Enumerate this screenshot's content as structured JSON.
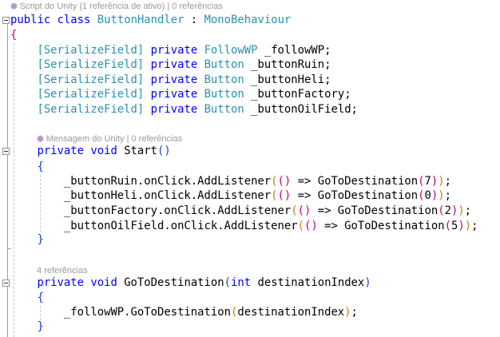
{
  "codelens": {
    "class": "Script do Unity (1 referência de ativo) | 0 referências",
    "start": "Mensagem do Unity | 0 referências",
    "goto": "4 referências"
  },
  "code_lines": [
    {
      "tokens": [
        [
          "public",
          "kw"
        ],
        [
          " ",
          ""
        ],
        [
          "class",
          "kw"
        ],
        [
          " ",
          ""
        ],
        [
          "ButtonHandler",
          "ty"
        ],
        [
          " : ",
          ""
        ],
        [
          "MonoBehaviour",
          "ty"
        ]
      ]
    },
    {
      "tokens": [
        [
          "{",
          "b2"
        ]
      ]
    },
    {
      "tokens": [
        [
          "    ",
          ""
        ],
        [
          "[SerializeField]",
          "ty"
        ],
        [
          " ",
          ""
        ],
        [
          "private",
          "kw"
        ],
        [
          " ",
          ""
        ],
        [
          "FollowWP",
          "ty"
        ],
        [
          " _followWP;",
          ""
        ]
      ]
    },
    {
      "tokens": [
        [
          "    ",
          ""
        ],
        [
          "[SerializeField]",
          "ty"
        ],
        [
          " ",
          ""
        ],
        [
          "private",
          "kw"
        ],
        [
          " ",
          ""
        ],
        [
          "Button",
          "ty"
        ],
        [
          " _buttonRuin;",
          ""
        ]
      ]
    },
    {
      "tokens": [
        [
          "    ",
          ""
        ],
        [
          "[SerializeField]",
          "ty"
        ],
        [
          " ",
          ""
        ],
        [
          "private",
          "kw"
        ],
        [
          " ",
          ""
        ],
        [
          "Button",
          "ty"
        ],
        [
          " _buttonHeli;",
          ""
        ]
      ]
    },
    {
      "tokens": [
        [
          "    ",
          ""
        ],
        [
          "[SerializeField]",
          "ty"
        ],
        [
          " ",
          ""
        ],
        [
          "private",
          "kw"
        ],
        [
          " ",
          ""
        ],
        [
          "Button",
          "ty"
        ],
        [
          " _buttonFactory;",
          ""
        ]
      ]
    },
    {
      "tokens": [
        [
          "    ",
          ""
        ],
        [
          "[SerializeField]",
          "ty"
        ],
        [
          " ",
          ""
        ],
        [
          "private",
          "kw"
        ],
        [
          " ",
          ""
        ],
        [
          "Button",
          "ty"
        ],
        [
          " _buttonOilField;",
          ""
        ]
      ]
    },
    {
      "tokens": [
        [
          "    ",
          ""
        ],
        [
          "private",
          "kw"
        ],
        [
          " ",
          ""
        ],
        [
          "void",
          "kw"
        ],
        [
          " Start",
          ""
        ],
        [
          "()",
          "b3"
        ]
      ]
    },
    {
      "tokens": [
        [
          "    ",
          ""
        ],
        [
          "{",
          "b3"
        ]
      ]
    },
    {
      "tokens": [
        [
          "        _buttonRuin.onClick.AddListener",
          ""
        ],
        [
          "(",
          "b1"
        ],
        [
          "()",
          "b2"
        ],
        [
          " => GoToDestination",
          ""
        ],
        [
          "(",
          "b2"
        ],
        [
          "7",
          ""
        ],
        [
          ")",
          "b2"
        ],
        [
          ")",
          "b1"
        ],
        [
          ";",
          ""
        ]
      ]
    },
    {
      "tokens": [
        [
          "        _buttonHeli.onClick.AddListener",
          ""
        ],
        [
          "(",
          "b1"
        ],
        [
          "()",
          "b2"
        ],
        [
          " => GoToDestination",
          ""
        ],
        [
          "(",
          "b2"
        ],
        [
          "0",
          ""
        ],
        [
          ")",
          "b2"
        ],
        [
          ")",
          "b1"
        ],
        [
          ";",
          ""
        ]
      ]
    },
    {
      "tokens": [
        [
          "        _buttonFactory.onClick.AddListener",
          ""
        ],
        [
          "(",
          "b1"
        ],
        [
          "()",
          "b2"
        ],
        [
          " => GoToDestination",
          ""
        ],
        [
          "(",
          "b2"
        ],
        [
          "2",
          ""
        ],
        [
          ")",
          "b2"
        ],
        [
          ")",
          "b1"
        ],
        [
          ";",
          ""
        ]
      ]
    },
    {
      "tokens": [
        [
          "        _buttonOilField.onClick.AddListener",
          ""
        ],
        [
          "(",
          "b1"
        ],
        [
          "()",
          "b2"
        ],
        [
          " => GoToDestination",
          ""
        ],
        [
          "(",
          "b2"
        ],
        [
          "5",
          ""
        ],
        [
          ")",
          "b2"
        ],
        [
          ")",
          "b1"
        ],
        [
          ";",
          ""
        ]
      ]
    },
    {
      "tokens": [
        [
          "    ",
          ""
        ],
        [
          "}",
          "b3"
        ]
      ]
    },
    {
      "tokens": [
        [
          "    ",
          ""
        ],
        [
          "private",
          "kw"
        ],
        [
          " ",
          ""
        ],
        [
          "void",
          "kw"
        ],
        [
          " GoToDestination",
          ""
        ],
        [
          "(",
          "b3"
        ],
        [
          "int",
          "kw"
        ],
        [
          " destinationIndex",
          ""
        ],
        [
          ")",
          "b3"
        ]
      ]
    },
    {
      "tokens": [
        [
          "    ",
          ""
        ],
        [
          "{",
          "b3"
        ]
      ]
    },
    {
      "tokens": [
        [
          "        _followWP.GoToDestination",
          ""
        ],
        [
          "(",
          "b1"
        ],
        [
          "destinationIndex",
          ""
        ],
        [
          ")",
          "b1"
        ],
        [
          ";",
          ""
        ]
      ]
    },
    {
      "tokens": [
        [
          "    ",
          ""
        ],
        [
          "}",
          "b3"
        ]
      ]
    }
  ]
}
